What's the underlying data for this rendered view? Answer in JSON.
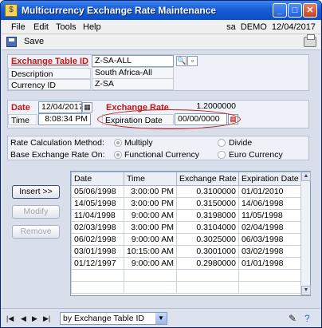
{
  "window": {
    "title": "Multicurrency Exchange Rate Maintenance"
  },
  "menu": {
    "items": [
      "File",
      "Edit",
      "Tools",
      "Help"
    ],
    "user": "sa  DEMO  12/04/2017"
  },
  "toolbar": {
    "save_label": "Save"
  },
  "header": {
    "exchange_table_id_label": "Exchange Table ID",
    "exchange_table_id_value": "Z-SA-ALL",
    "description_label": "Description",
    "description_value": "South Africa-All",
    "currency_id_label": "Currency ID",
    "currency_id_value": "Z-SA"
  },
  "rate": {
    "date_label": "Date",
    "date_value": "12/04/2017",
    "time_label": "Time",
    "time_value": "8:08:34 PM",
    "exchange_rate_label": "Exchange Rate",
    "exchange_rate_value": "1.2000000",
    "expiration_label": "Expiration Date",
    "expiration_value": "00/00/0000"
  },
  "options": {
    "calc_label": "Rate Calculation Method:",
    "calc_opt1": "Multiply",
    "calc_opt2": "Divide",
    "base_label": "Base Exchange Rate On:",
    "base_opt1": "Functional Currency",
    "base_opt2": "Euro Currency"
  },
  "buttons": {
    "insert": "Insert >>",
    "modify": "Modify",
    "remove": "Remove"
  },
  "grid": {
    "headers": [
      "Date",
      "Time",
      "Exchange Rate",
      "Expiration Date"
    ],
    "rows": [
      [
        "05/06/1998",
        "3:00:00 PM",
        "0.3100000",
        "01/01/2010"
      ],
      [
        "14/05/1998",
        "3:00:00 PM",
        "0.3150000",
        "14/06/1998"
      ],
      [
        "11/04/1998",
        "9:00:00 AM",
        "0.3198000",
        "11/05/1998"
      ],
      [
        "02/03/1998",
        "3:00:00 PM",
        "0.3104000",
        "02/04/1998"
      ],
      [
        "06/02/1998",
        "9:00:00 AM",
        "0.3025000",
        "06/03/1998"
      ],
      [
        "03/01/1998",
        "10:15:00 AM",
        "0.3001000",
        "03/02/1998"
      ],
      [
        "01/12/1997",
        "9:00:00 AM",
        "0.2980000",
        "01/01/1998"
      ]
    ]
  },
  "status": {
    "sort_value": "by Exchange Table ID"
  }
}
